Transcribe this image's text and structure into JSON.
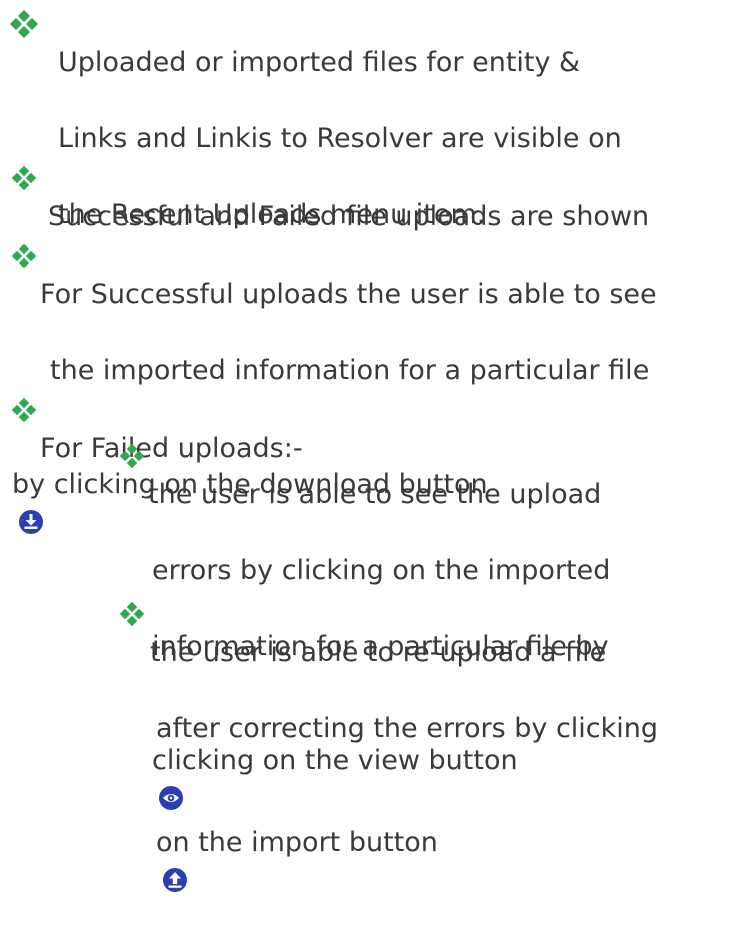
{
  "colors": {
    "bullet": "#2fa84f",
    "text": "#3a3a3a",
    "icon": "#2a3fb0"
  },
  "bullets": [
    {
      "icon": "diamond-bullet-icon",
      "lines": [
        "Uploaded or imported files for entity &",
        "Links and Linkis to Resolver are visible on",
        "the Recent Uploads menu item."
      ]
    },
    {
      "icon": "diamond-bullet-icon",
      "lines": [
        "Successful and Failed file uploads are shown"
      ]
    },
    {
      "icon": "diamond-bullet-icon",
      "lines": [
        "For Successful uploads the user is able to see",
        "the imported information for a particular file",
        "by clicking on the download button"
      ],
      "trailing_icon": "download-icon"
    },
    {
      "icon": "diamond-bullet-icon",
      "lines": [
        "For Failed  uploads:-"
      ]
    }
  ],
  "sub_bullets": [
    {
      "icon": "diamond-bullet-icon",
      "lines": [
        "the user is able to see the upload",
        "errors by clicking on the imported",
        "information for a particular file by",
        "clicking on the view button"
      ],
      "trailing_icon": "view-eye-icon"
    },
    {
      "icon": "diamond-bullet-icon",
      "lines": [
        " the user is able to  re-upload a file",
        "after correcting the errors by clicking",
        "on the  import button"
      ],
      "trailing_icon": "import-upload-icon"
    }
  ]
}
